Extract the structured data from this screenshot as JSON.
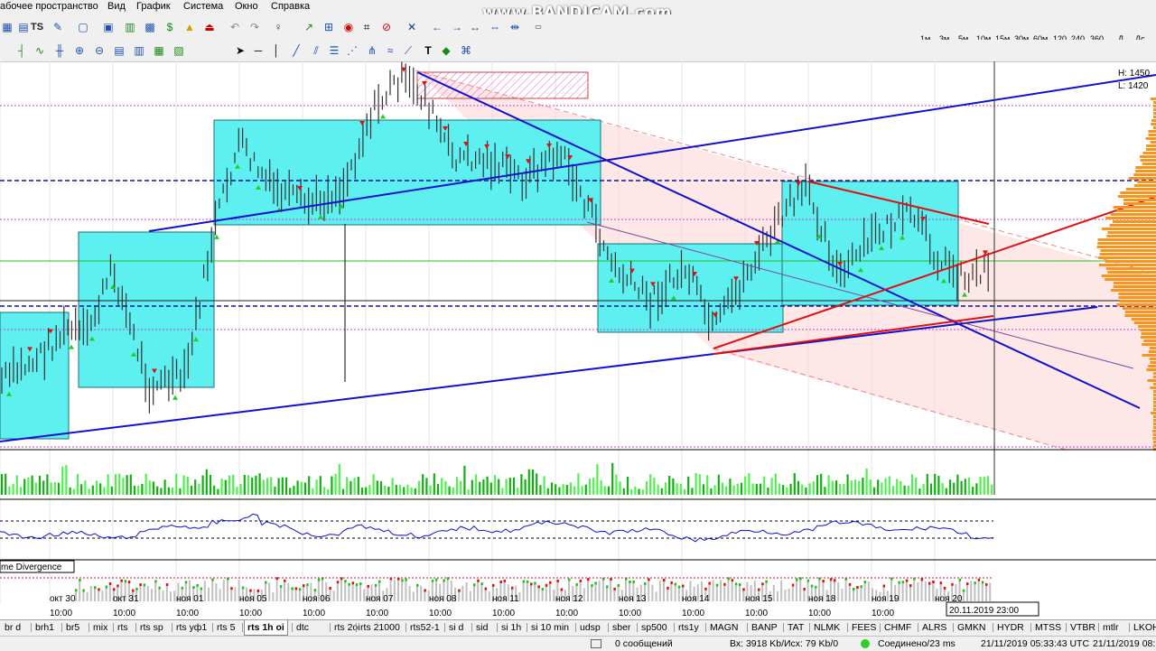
{
  "menu": {
    "items": [
      "абочее пространство",
      "Вид",
      "График",
      "Система",
      "Окно",
      "Справка"
    ]
  },
  "watermark": "www.BANDICAM.com",
  "toolbar": {
    "ts_label": "TS",
    "timeframes": [
      "1м",
      "3м",
      "5м",
      "10м",
      "15м",
      "30м",
      "60м",
      "120",
      "240",
      "360",
      "Д",
      "Дс"
    ]
  },
  "chart": {
    "price_labels": [
      "H: 1450",
      "L: 1420"
    ],
    "date_labels": [
      "окт 30",
      "окт 31",
      "ноя 01",
      "ноя 05",
      "ноя 06",
      "ноя 07",
      "ноя 08",
      "ноя 11",
      "ноя 12",
      "ноя 13",
      "ноя 14",
      "ноя 15",
      "ноя 18",
      "ноя 19",
      "ноя 20"
    ],
    "time_label": "10:00",
    "cursor_datetime": "20.11.2019  23:00",
    "indicator_label": "me Divergence",
    "colors": {
      "box": "#5ef0f0",
      "trend": "#1010d0",
      "red_line": "#e01010",
      "profile": "#f7941d"
    }
  },
  "tabs": [
    "br d",
    "brh1",
    "br5",
    "mix",
    "rts",
    "rts sp",
    "rts уф1",
    "rts 5",
    "rts 1h oi",
    "dtc",
    "rts 2oi",
    "rts 21000",
    "rts52-1",
    "si d",
    "sid",
    "si 1h",
    "si 10 min",
    "udsp",
    "sber",
    "sp500",
    "rts1y",
    "MAGN",
    "BANP",
    "TAT",
    "NLMK",
    "FEES",
    "CHMF",
    "ALRS",
    "GMKN",
    "HYDR",
    "MTSS",
    "VTBR",
    "mtlr",
    "LKOH"
  ],
  "active_tab": "rts 1h oi",
  "status": {
    "messages": "0 сообщений",
    "traffic": "Вх: 3918 Kb/Исх: 79 Kb/0",
    "connection": "Соединено/23 ms",
    "time_utc": "21/11/2019 05:33:43 UTC",
    "time_local": "21/11/2019 08:"
  }
}
